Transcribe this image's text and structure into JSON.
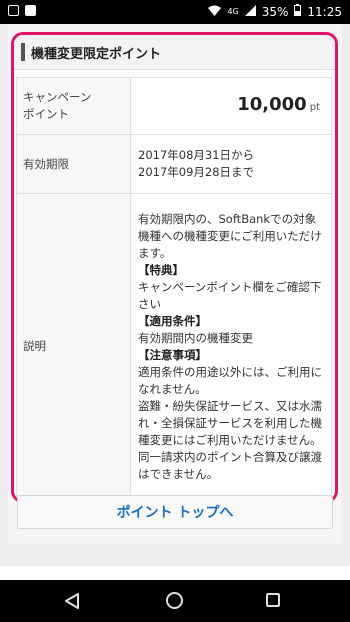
{
  "status_bar": {
    "network": "4G",
    "battery": "35%",
    "time": "11:25"
  },
  "card": {
    "title": "機種変更限定ポイント",
    "rows": {
      "points_label_line1": "キャンペーン",
      "points_label_line2": "ポイント",
      "points_value": "10,000",
      "points_unit": "pt",
      "period_label": "有効期限",
      "period_line1": "2017年08月31日から",
      "period_line2": "2017年09月28日まで",
      "desc_label": "説明",
      "desc_intro": "有効期限内の、SoftBankでの対象機種への機種変更にご利用いただけます。",
      "benefit_heading": "【特典】",
      "benefit_text": "キャンペーンポイント欄をご確認下さい",
      "condition_heading": "【適用条件】",
      "condition_text": "有効期間内の機種変更",
      "notes_heading": "【注意事項】",
      "notes_1": "適用条件の用途以外には、ご利用になれません。",
      "notes_2": "盗難・紛失保証サービス、又は水濡れ・全損保証サービスを利用した機種変更にはご利用いただけません。",
      "notes_3": "同一請求内のポイント合算及び譲渡はできません。"
    }
  },
  "button": {
    "label": "ポイント トップへ"
  },
  "colors": {
    "highlight_border": "#e2136a",
    "link_blue": "#1a6fbf"
  },
  "icons": [
    "back-icon",
    "home-icon",
    "recent-apps-icon",
    "battery-icon",
    "signal-icon",
    "wifi-icon"
  ]
}
